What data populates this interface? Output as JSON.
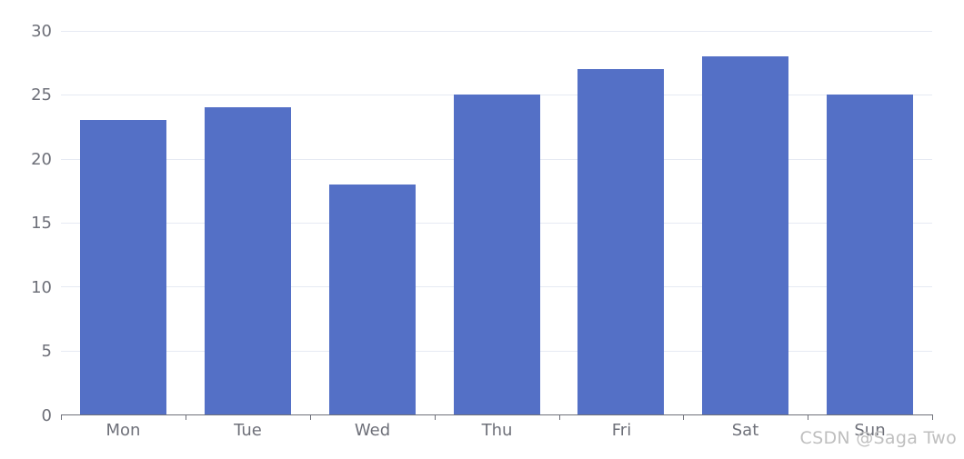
{
  "chart_data": {
    "type": "bar",
    "title": "",
    "subtitle": "",
    "xlabel": "",
    "ylabel": "",
    "categories": [
      "Mon",
      "Tue",
      "Wed",
      "Thu",
      "Fri",
      "Sat",
      "Sun"
    ],
    "values": [
      23,
      24,
      18,
      25,
      27,
      28,
      25
    ],
    "series": [
      {
        "name": "",
        "values": [
          23,
          24,
          18,
          25,
          27,
          28,
          25
        ]
      }
    ],
    "ylim": [
      0,
      30
    ],
    "y_ticks": [
      0,
      5,
      10,
      15,
      20,
      25,
      30
    ],
    "y_tick_labels": [
      "0",
      "5",
      "10",
      "15",
      "20",
      "25",
      "30"
    ],
    "grid": true,
    "grid_axis": "y",
    "legend": null,
    "bar_color": "#5470C6",
    "grid_color": "#E6EAF3",
    "axis_color": "#6E7079",
    "label_color": "#6E7079"
  },
  "watermark": {
    "text": "CSDN @Saga Two",
    "color": "#BFBFBF"
  }
}
